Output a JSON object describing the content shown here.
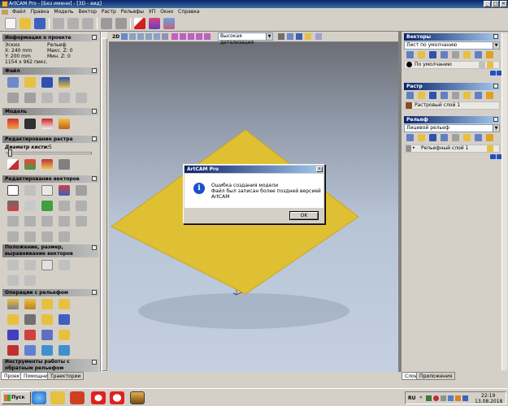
{
  "window": {
    "title": "ArtCAM Pro - [Без имени] - [3D - вид]"
  },
  "menu": [
    "Файл",
    "Правка",
    "Модель",
    "Вектор",
    "Растр",
    "Рельефы",
    "УП",
    "Окно",
    "Справка"
  ],
  "left": {
    "project_info": {
      "header": "Информация о проекте",
      "sketch_label": "Эскиз",
      "relief_label": "Рельеф",
      "x": "X: 240 mm",
      "y": "Y: 200 mm",
      "pixels": "1154 x 962 пикс.",
      "max_z": "Макс. Z: 0",
      "min_z": "Мин. Z: 0"
    },
    "file_header": "Файл",
    "model_header": "Модель",
    "raster_edit_header": "Редактирование растра",
    "brush_label": "Диаметр кисти:",
    "brush_value": "5",
    "vector_edit_header": "Редактирование векторов",
    "position_header": "Положение, размер, выравнивание векторов",
    "relief_ops_header": "Операции с рельефом",
    "reverse_relief_header": "Инструменты работы с обратным рельефом",
    "tabs": [
      "Проект",
      "Помощник",
      "Траектории"
    ]
  },
  "viewport": {
    "mode_label": "2D",
    "detail": "Высокая детализация"
  },
  "right": {
    "vectors_header": "Векторы",
    "vectors_select": "Лист по умолчанию",
    "vectors_layer": "По умолчанию",
    "raster_header": "Растр",
    "raster_layer": "Растровый слой 1",
    "relief_header": "Рельеф",
    "relief_select": "Лицевой рельеф",
    "relief_layer": "Рельефный слой 1",
    "tabs": [
      "Слои",
      "Приложения"
    ]
  },
  "dialog": {
    "title": "ArtCAM Pro",
    "line1": "Ошибка создания модели",
    "line2": "Файл был записан более поздней версией ArtCAM",
    "ok": "OK"
  },
  "taskbar": {
    "start": "Пуск",
    "lang": "RU",
    "time": "22:19",
    "date": "13.08.2018"
  }
}
